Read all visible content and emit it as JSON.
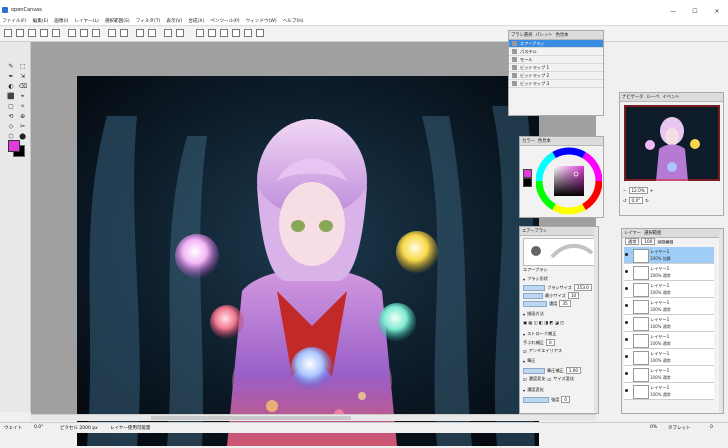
{
  "window": {
    "title": "openCanvas",
    "controls": [
      "—",
      "☐",
      "✕"
    ]
  },
  "menu": [
    "ファイル(F)",
    "編集(E)",
    "画像(I)",
    "レイヤー(L)",
    "選択範囲(S)",
    "フィルタ(T)",
    "表示(V)",
    "合成(X)",
    "ペンツール(P)",
    "ウィンドウ(W)",
    "ヘルプ(H)"
  ],
  "toolbar": {
    "icons": [
      "new-icon",
      "open-icon",
      "save-icon",
      "save-as-icon",
      "print-icon",
      "copy-icon",
      "paste-icon",
      "cut-icon",
      "select-all-icon",
      "deselect-icon",
      "move-icon",
      "zoom-in-icon",
      "zoom-out-icon",
      "hand-icon",
      "rotate-left-icon",
      "rotate-right-icon",
      "reset-icon"
    ]
  },
  "tools": [
    "✎",
    "⬚",
    "✒",
    "⇲",
    "◐",
    "⌫",
    "⬛",
    "⌖",
    "▢",
    "✧",
    "⟲",
    "⊕",
    "◇",
    "✂",
    "⬡",
    "⬤"
  ],
  "colors": {
    "foreground": "#e13ad8",
    "background": "#000000",
    "selection": "#3a8be2"
  },
  "brush_panel": {
    "tabs": [
      "ブラシ選択",
      "パレット",
      "色見本"
    ],
    "items": [
      "エアーブラシ",
      "パステル",
      "モール",
      "ビットマップ 1",
      "ビットマップ 2",
      "ビットマップ 3"
    ],
    "selected": 0
  },
  "navigator": {
    "tabs": [
      "ナビゲータ",
      "ルーペ",
      "イベント"
    ],
    "zoom": "12.0%",
    "angle": "0.0°"
  },
  "color_panel": {
    "tabs": [
      "カラー",
      "色見本"
    ]
  },
  "brush_settings": {
    "tab": "エアーブラシ",
    "brush_name": "エアーブラシ",
    "size_label": "ブラシサイズ",
    "size_value": "353.0",
    "min_size_label": "最小サイズ",
    "min_size_value": "10",
    "density_label": "濃度",
    "density_value": "35",
    "section_drawing": "描画方法",
    "section_stroke": "ストローク補正",
    "stroke_label": "手ぶれ補正",
    "stroke_value": "0",
    "antialias": "アンチエイリアス",
    "section_pressure": "筆圧",
    "pressure_label": "筆圧補正",
    "pressure_value": "1.00",
    "opt1": "濃度変化",
    "opt2": "サイズ変化",
    "section_texture": "濃度変化",
    "texture_label": "強度",
    "texture_value": "0"
  },
  "layer_panel": {
    "tabs": [
      "レイヤー",
      "選択範囲"
    ],
    "header_mode": "通常",
    "header_opacity": "100",
    "layers": [
      {
        "name": "レイヤー1",
        "mode": "100% 加算"
      },
      {
        "name": "レイヤー1",
        "mode": "100% 通常"
      },
      {
        "name": "レイヤー1",
        "mode": "100% 通常"
      },
      {
        "name": "レイヤー1",
        "mode": "100% 通常"
      },
      {
        "name": "レイヤー1",
        "mode": "100% 通常"
      },
      {
        "name": "レイヤー1",
        "mode": "100% 通常"
      },
      {
        "name": "レイヤー1",
        "mode": "100% 通常"
      },
      {
        "name": "レイヤー1",
        "mode": "100% 通常"
      },
      {
        "name": "レイヤー1",
        "mode": "100% 通常"
      }
    ]
  },
  "status": {
    "left1": "ウェイト",
    "left2": "0.0°",
    "left3": "ピクセル 2000 px",
    "left4": "レイヤー使用可能量",
    "right1": "0%",
    "right2": "タブレット",
    "right3": "0"
  }
}
